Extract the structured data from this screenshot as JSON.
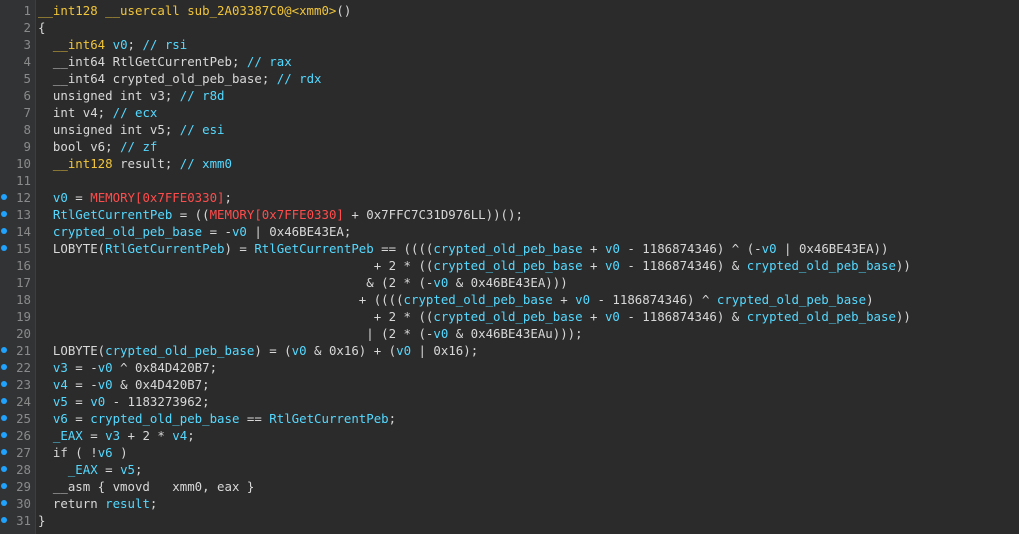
{
  "colors": {
    "background": "#2b2b2b",
    "gutter": "#313335",
    "line_number": "#8a8a8a",
    "breakpoint_dot": "#1fa3ff",
    "type": "#f0c53c",
    "identifier": "#55d9ff",
    "plain": "#d8d8d8",
    "memory": "#ff4c4c"
  },
  "dot_lines": [
    12,
    13,
    14,
    15,
    21,
    22,
    23,
    24,
    25,
    26,
    27,
    28,
    29,
    30,
    31
  ],
  "lines": [
    {
      "n": 1,
      "tokens": [
        {
          "c": "t",
          "s": "__int128 __usercall sub_2A03387C0@<xmm0>"
        },
        {
          "c": "p",
          "s": "()"
        }
      ]
    },
    {
      "n": 2,
      "tokens": [
        {
          "c": "p",
          "s": "{"
        }
      ]
    },
    {
      "n": 3,
      "tokens": [
        {
          "c": "p",
          "s": "  "
        },
        {
          "c": "t",
          "s": "__int64"
        },
        {
          "c": "p",
          "s": " "
        },
        {
          "c": "v",
          "s": "v0"
        },
        {
          "c": "p",
          "s": "; "
        },
        {
          "c": "c",
          "s": "// rsi"
        }
      ]
    },
    {
      "n": 4,
      "tokens": [
        {
          "c": "p",
          "s": "  __int64 "
        },
        {
          "c": "p",
          "s": "RtlGetCurrentPeb"
        },
        {
          "c": "p",
          "s": "; "
        },
        {
          "c": "c",
          "s": "// rax"
        }
      ]
    },
    {
      "n": 5,
      "tokens": [
        {
          "c": "p",
          "s": "  __int64 "
        },
        {
          "c": "p",
          "s": "crypted_old_peb_base"
        },
        {
          "c": "p",
          "s": "; "
        },
        {
          "c": "c",
          "s": "// rdx"
        }
      ]
    },
    {
      "n": 6,
      "tokens": [
        {
          "c": "p",
          "s": "  unsigned int v3; "
        },
        {
          "c": "c",
          "s": "// r8d"
        }
      ]
    },
    {
      "n": 7,
      "tokens": [
        {
          "c": "p",
          "s": "  int v4; "
        },
        {
          "c": "c",
          "s": "// ecx"
        }
      ]
    },
    {
      "n": 8,
      "tokens": [
        {
          "c": "p",
          "s": "  unsigned int v5; "
        },
        {
          "c": "c",
          "s": "// esi"
        }
      ]
    },
    {
      "n": 9,
      "tokens": [
        {
          "c": "p",
          "s": "  bool v6; "
        },
        {
          "c": "c",
          "s": "// zf"
        }
      ]
    },
    {
      "n": 10,
      "tokens": [
        {
          "c": "p",
          "s": "  "
        },
        {
          "c": "t",
          "s": "__int128"
        },
        {
          "c": "p",
          "s": " result; "
        },
        {
          "c": "c",
          "s": "// xmm0"
        }
      ]
    },
    {
      "n": 11,
      "tokens": [
        {
          "c": "p",
          "s": ""
        }
      ]
    },
    {
      "n": 12,
      "tokens": [
        {
          "c": "p",
          "s": "  "
        },
        {
          "c": "v",
          "s": "v0"
        },
        {
          "c": "p",
          "s": " = "
        },
        {
          "c": "r",
          "s": "MEMORY[0x7FFE0330]"
        },
        {
          "c": "p",
          "s": ";"
        }
      ]
    },
    {
      "n": 13,
      "tokens": [
        {
          "c": "p",
          "s": "  "
        },
        {
          "c": "v",
          "s": "RtlGetCurrentPeb"
        },
        {
          "c": "p",
          "s": " = (("
        },
        {
          "c": "r",
          "s": "MEMORY[0x7FFE0330]"
        },
        {
          "c": "p",
          "s": " + 0x7FFC7C31D976LL))();"
        }
      ]
    },
    {
      "n": 14,
      "tokens": [
        {
          "c": "p",
          "s": "  "
        },
        {
          "c": "v",
          "s": "crypted_old_peb_base"
        },
        {
          "c": "p",
          "s": " = -"
        },
        {
          "c": "v",
          "s": "v0"
        },
        {
          "c": "p",
          "s": " | 0x46BE43EA;"
        }
      ]
    },
    {
      "n": 15,
      "tokens": [
        {
          "c": "p",
          "s": "  LOBYTE("
        },
        {
          "c": "v",
          "s": "RtlGetCurrentPeb"
        },
        {
          "c": "p",
          "s": ") = "
        },
        {
          "c": "v",
          "s": "RtlGetCurrentPeb"
        },
        {
          "c": "p",
          "s": " == (((("
        },
        {
          "c": "v",
          "s": "crypted_old_peb_base"
        },
        {
          "c": "p",
          "s": " + "
        },
        {
          "c": "v",
          "s": "v0"
        },
        {
          "c": "p",
          "s": " - 1186874346) ^ (-"
        },
        {
          "c": "v",
          "s": "v0"
        },
        {
          "c": "p",
          "s": " | 0x46BE43EA))"
        }
      ]
    },
    {
      "n": 16,
      "tokens": [
        {
          "c": "p",
          "s": "                                             + 2 * (("
        },
        {
          "c": "v",
          "s": "crypted_old_peb_base"
        },
        {
          "c": "p",
          "s": " + "
        },
        {
          "c": "v",
          "s": "v0"
        },
        {
          "c": "p",
          "s": " - 1186874346) & "
        },
        {
          "c": "v",
          "s": "crypted_old_peb_base"
        },
        {
          "c": "p",
          "s": "))"
        }
      ]
    },
    {
      "n": 17,
      "tokens": [
        {
          "c": "p",
          "s": "                                            & (2 * (-"
        },
        {
          "c": "v",
          "s": "v0"
        },
        {
          "c": "p",
          "s": " & 0x46BE43EA)))"
        }
      ]
    },
    {
      "n": 18,
      "tokens": [
        {
          "c": "p",
          "s": "                                           + (((("
        },
        {
          "c": "v",
          "s": "crypted_old_peb_base"
        },
        {
          "c": "p",
          "s": " + "
        },
        {
          "c": "v",
          "s": "v0"
        },
        {
          "c": "p",
          "s": " - 1186874346) ^ "
        },
        {
          "c": "v",
          "s": "crypted_old_peb_base"
        },
        {
          "c": "p",
          "s": ")"
        }
      ]
    },
    {
      "n": 19,
      "tokens": [
        {
          "c": "p",
          "s": "                                             + 2 * (("
        },
        {
          "c": "v",
          "s": "crypted_old_peb_base"
        },
        {
          "c": "p",
          "s": " + "
        },
        {
          "c": "v",
          "s": "v0"
        },
        {
          "c": "p",
          "s": " - 1186874346) & "
        },
        {
          "c": "v",
          "s": "crypted_old_peb_base"
        },
        {
          "c": "p",
          "s": "))"
        }
      ]
    },
    {
      "n": 20,
      "tokens": [
        {
          "c": "p",
          "s": "                                            | (2 * (-"
        },
        {
          "c": "v",
          "s": "v0"
        },
        {
          "c": "p",
          "s": " & 0x46BE43EAu)));"
        }
      ]
    },
    {
      "n": 21,
      "tokens": [
        {
          "c": "p",
          "s": "  LOBYTE("
        },
        {
          "c": "v",
          "s": "crypted_old_peb_base"
        },
        {
          "c": "p",
          "s": ") = ("
        },
        {
          "c": "v",
          "s": "v0"
        },
        {
          "c": "p",
          "s": " & 0x16) + ("
        },
        {
          "c": "v",
          "s": "v0"
        },
        {
          "c": "p",
          "s": " | 0x16);"
        }
      ]
    },
    {
      "n": 22,
      "tokens": [
        {
          "c": "p",
          "s": "  "
        },
        {
          "c": "v",
          "s": "v3"
        },
        {
          "c": "p",
          "s": " = -"
        },
        {
          "c": "v",
          "s": "v0"
        },
        {
          "c": "p",
          "s": " ^ 0x84D420B7;"
        }
      ]
    },
    {
      "n": 23,
      "tokens": [
        {
          "c": "p",
          "s": "  "
        },
        {
          "c": "v",
          "s": "v4"
        },
        {
          "c": "p",
          "s": " = -"
        },
        {
          "c": "v",
          "s": "v0"
        },
        {
          "c": "p",
          "s": " & 0x4D420B7;"
        }
      ]
    },
    {
      "n": 24,
      "tokens": [
        {
          "c": "p",
          "s": "  "
        },
        {
          "c": "v",
          "s": "v5"
        },
        {
          "c": "p",
          "s": " = "
        },
        {
          "c": "v",
          "s": "v0"
        },
        {
          "c": "p",
          "s": " - 1183273962;"
        }
      ]
    },
    {
      "n": 25,
      "tokens": [
        {
          "c": "p",
          "s": "  "
        },
        {
          "c": "v",
          "s": "v6"
        },
        {
          "c": "p",
          "s": " = "
        },
        {
          "c": "v",
          "s": "crypted_old_peb_base"
        },
        {
          "c": "p",
          "s": " == "
        },
        {
          "c": "v",
          "s": "RtlGetCurrentPeb"
        },
        {
          "c": "p",
          "s": ";"
        }
      ]
    },
    {
      "n": 26,
      "tokens": [
        {
          "c": "p",
          "s": "  "
        },
        {
          "c": "v",
          "s": "_EAX"
        },
        {
          "c": "p",
          "s": " = "
        },
        {
          "c": "v",
          "s": "v3"
        },
        {
          "c": "p",
          "s": " + 2 * "
        },
        {
          "c": "v",
          "s": "v4"
        },
        {
          "c": "p",
          "s": ";"
        }
      ]
    },
    {
      "n": 27,
      "tokens": [
        {
          "c": "p",
          "s": "  if ( !"
        },
        {
          "c": "v",
          "s": "v6"
        },
        {
          "c": "p",
          "s": " )"
        }
      ]
    },
    {
      "n": 28,
      "tokens": [
        {
          "c": "p",
          "s": "    "
        },
        {
          "c": "v",
          "s": "_EAX"
        },
        {
          "c": "p",
          "s": " = "
        },
        {
          "c": "v",
          "s": "v5"
        },
        {
          "c": "p",
          "s": ";"
        }
      ]
    },
    {
      "n": 29,
      "tokens": [
        {
          "c": "p",
          "s": "  __asm { vmovd   xmm0, eax }"
        }
      ]
    },
    {
      "n": 30,
      "tokens": [
        {
          "c": "p",
          "s": "  return "
        },
        {
          "c": "v",
          "s": "result"
        },
        {
          "c": "p",
          "s": ";"
        }
      ]
    },
    {
      "n": 31,
      "tokens": [
        {
          "c": "p",
          "s": "}"
        }
      ]
    }
  ]
}
